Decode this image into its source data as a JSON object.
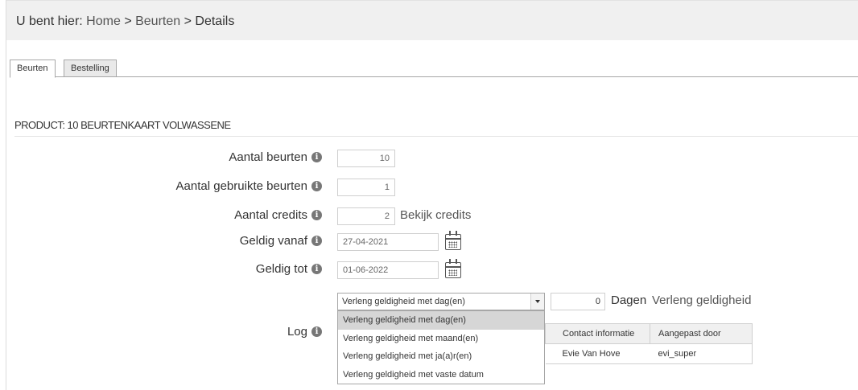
{
  "breadcrumb": {
    "prefix": "U bent hier:",
    "home": "Home",
    "sep1": ">",
    "beurten": "Beurten",
    "sep2": ">",
    "current": "Details"
  },
  "tabs": [
    {
      "label": "Beurten",
      "active": true
    },
    {
      "label": "Bestelling",
      "active": false
    }
  ],
  "section_title": "PRODUCT: 10 BEURTENKAART VOLWASSENE",
  "fields": {
    "aantal_beurten": {
      "label": "Aantal beurten",
      "value": "10"
    },
    "aantal_gebruikte": {
      "label": "Aantal gebruikte beurten",
      "value": "1"
    },
    "aantal_credits": {
      "label": "Aantal credits",
      "value": "2",
      "link": "Bekijk credits"
    },
    "geldig_vanaf": {
      "label": "Geldig vanaf",
      "value": "27-04-2021"
    },
    "geldig_tot": {
      "label": "Geldig tot",
      "value": "01-06-2022"
    }
  },
  "extend": {
    "selected": "Verleng geldigheid met dag(en)",
    "options": [
      "Verleng geldigheid met dag(en)",
      "Verleng geldigheid met maand(en)",
      "Verleng geldigheid met ja(a)r(en)",
      "Verleng geldigheid met vaste datum"
    ],
    "days_value": "0",
    "days_label": "Dagen",
    "extend_link": "Verleng geldigheid"
  },
  "log": {
    "label": "Log",
    "columns": [
      "Contact informatie",
      "Aangepast door"
    ],
    "rows": [
      [
        "Evie Van Hove",
        "evi_super"
      ]
    ]
  },
  "icons": {
    "info": "info-icon",
    "calendar": "calendar-icon"
  }
}
